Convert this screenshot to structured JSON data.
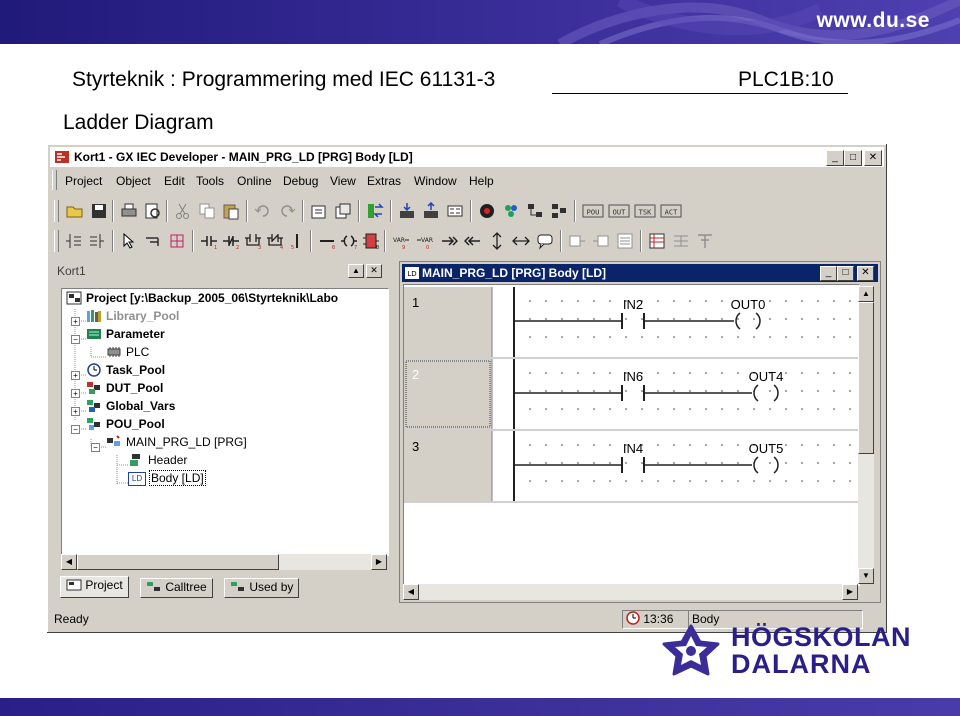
{
  "slide": {
    "site": "www.du.se",
    "title": "Styrteknik : Programmering med IEC 61131-3",
    "number": "PLC1B:10",
    "subtitle": "Ladder Diagram",
    "logo_line1": "HÖGSKOLAN",
    "logo_line2": "DALARNA"
  },
  "window": {
    "title": "Kort1 - GX IEC Developer - MAIN_PRG_LD [PRG] Body [LD]",
    "menu": [
      "Project",
      "Object",
      "Edit",
      "Tools",
      "Online",
      "Debug",
      "View",
      "Extras",
      "Window",
      "Help"
    ]
  },
  "toolbar_icons": {
    "row1": [
      "open-folder",
      "save",
      "print",
      "print-preview",
      "cut",
      "copy",
      "paste",
      "undo",
      "redo",
      "properties",
      "open-pou",
      "transfer",
      "download",
      "upload",
      "compare",
      "monitor",
      "variables",
      "structure",
      "pou",
      "out",
      "tsk",
      "act"
    ],
    "row1_labels": [
      "POU",
      "OUT",
      "TSK",
      "ACT"
    ],
    "row2_small": [
      "1",
      "2",
      "3",
      "4",
      "5",
      "6",
      "7",
      "8",
      "9",
      "0"
    ],
    "row2_var": [
      "VAR",
      "VAR"
    ]
  },
  "project_pane": {
    "caption": "Kort1",
    "tree": [
      {
        "label": "Project [y:\\Backup_2005_06\\Styrteknik\\Labo",
        "bold": true,
        "gray": false
      },
      {
        "label": "Library_Pool",
        "bold": true,
        "gray": true
      },
      {
        "label": "Parameter",
        "bold": true,
        "gray": false
      },
      {
        "label": "PLC",
        "bold": false,
        "gray": false
      },
      {
        "label": "Task_Pool",
        "bold": true,
        "gray": false
      },
      {
        "label": "DUT_Pool",
        "bold": true,
        "gray": false
      },
      {
        "label": "Global_Vars",
        "bold": true,
        "gray": false
      },
      {
        "label": "POU_Pool",
        "bold": true,
        "gray": false
      },
      {
        "label": "MAIN_PRG_LD [PRG]",
        "bold": false,
        "gray": false
      },
      {
        "label": "Header",
        "bold": false,
        "gray": false
      },
      {
        "label": "Body [LD]",
        "bold": false,
        "gray": false
      }
    ],
    "tabs": [
      "Project",
      "Calltree",
      "Used by"
    ],
    "ld_badge": "LD"
  },
  "editor": {
    "title": "MAIN_PRG_LD [PRG] Body [LD]",
    "rungs": [
      {
        "number": "1",
        "contact": "IN2",
        "coil": "OUT0"
      },
      {
        "number": "2",
        "contact": "IN6",
        "coil": "OUT4"
      },
      {
        "number": "3",
        "contact": "IN4",
        "coil": "OUT5"
      }
    ]
  },
  "status": {
    "left": "Ready",
    "time": "13:36",
    "mode": "Body"
  },
  "colors": {
    "banner": "#2a1f88",
    "titlebar_active": "#0a246a",
    "face": "#d4d0c8"
  }
}
